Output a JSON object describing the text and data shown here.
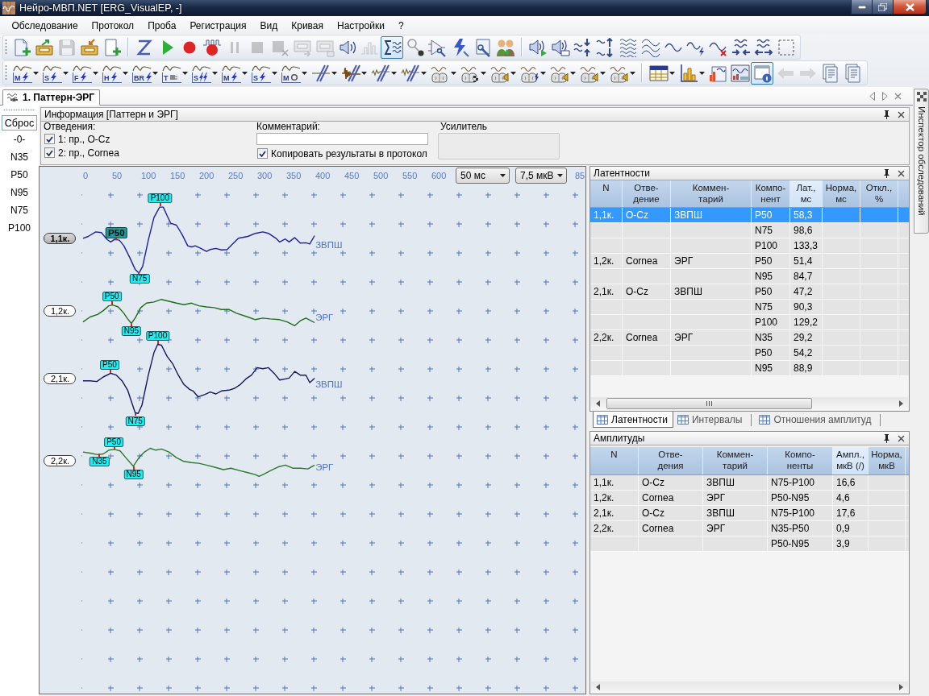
{
  "window": {
    "title": "Нейро-МВП.NET [ERG_VisualEP, -]"
  },
  "menu": [
    "Обследование",
    "Протокол",
    "Проба",
    "Регистрация",
    "Вид",
    "Кривая",
    "Настройки",
    "?"
  ],
  "toolbars": [
    {
      "buttons": [
        {
          "disabled": false,
          "pressed": false
        },
        {
          "disabled": false,
          "pressed": false
        },
        {
          "disabled": true,
          "pressed": false
        },
        {
          "disabled": false,
          "pressed": false
        },
        {
          "disabled": false,
          "pressed": false
        },
        {
          "disabled": false,
          "pressed": false
        },
        {
          "disabled": false,
          "pressed": false
        },
        {
          "disabled": false,
          "pressed": false
        },
        {
          "disabled": false,
          "pressed": false
        },
        {
          "disabled": true,
          "pressed": false
        },
        {
          "disabled": true,
          "pressed": false
        },
        {
          "disabled": true,
          "pressed": false
        },
        {
          "disabled": true,
          "pressed": false
        },
        {
          "disabled": true,
          "pressed": false
        },
        {
          "disabled": false,
          "pressed": false
        },
        {
          "disabled": true,
          "pressed": false
        },
        {
          "disabled": false,
          "pressed": true
        },
        {
          "disabled": false,
          "pressed": false
        },
        {
          "disabled": false,
          "pressed": false
        },
        {
          "disabled": false,
          "pressed": false
        },
        {
          "disabled": false,
          "pressed": false
        },
        {
          "disabled": false,
          "pressed": false
        },
        {
          "disabled": false,
          "pressed": false
        },
        {
          "disabled": false,
          "pressed": false
        },
        {
          "disabled": false,
          "pressed": false
        },
        {
          "disabled": false,
          "pressed": false
        },
        {
          "disabled": false,
          "pressed": false
        },
        {
          "disabled": false,
          "pressed": false
        },
        {
          "disabled": false,
          "pressed": false
        },
        {
          "disabled": false,
          "pressed": false
        },
        {
          "disabled": false,
          "pressed": false
        },
        {
          "disabled": false,
          "pressed": false
        },
        {
          "disabled": false,
          "pressed": false
        },
        {
          "disabled": false,
          "pressed": false
        }
      ]
    },
    {
      "buttons": [
        {
          "label": "M",
          "disabled": false,
          "pressed": false
        },
        {
          "label": "S",
          "disabled": false,
          "pressed": false
        },
        {
          "label": "F",
          "disabled": false,
          "pressed": false
        },
        {
          "label": "H",
          "disabled": false,
          "pressed": false
        },
        {
          "label": "BR",
          "disabled": false,
          "pressed": false
        },
        {
          "label": "T",
          "disabled": false,
          "pressed": false
        },
        {
          "label": "S",
          "disabled": false,
          "pressed": false
        },
        {
          "label": "M",
          "disabled": false,
          "pressed": false
        },
        {
          "label": "S",
          "disabled": false,
          "pressed": false
        },
        {
          "label": "M",
          "disabled": false,
          "pressed": false
        },
        {
          "disabled": false,
          "pressed": false
        },
        {
          "disabled": false,
          "pressed": false
        },
        {
          "disabled": false,
          "pressed": false
        },
        {
          "disabled": false,
          "pressed": false
        },
        {
          "disabled": false,
          "pressed": false
        },
        {
          "disabled": false,
          "pressed": false
        },
        {
          "disabled": false,
          "pressed": false
        },
        {
          "disabled": false,
          "pressed": false
        },
        {
          "disabled": false,
          "pressed": false
        },
        {
          "disabled": false,
          "pressed": false
        },
        {
          "disabled": false,
          "pressed": false
        },
        {
          "disabled": false,
          "pressed": false
        },
        {
          "disabled": false,
          "pressed": false
        },
        {
          "disabled": false,
          "pressed": false
        },
        {
          "disabled": false,
          "pressed": false
        },
        {
          "disabled": false,
          "pressed": true
        },
        {
          "disabled": true,
          "pressed": false
        },
        {
          "disabled": true,
          "pressed": false
        },
        {
          "disabled": false,
          "pressed": false
        },
        {
          "disabled": false,
          "pressed": false
        }
      ]
    }
  ],
  "document_tabs": [
    {
      "label": "1. Паттерн-ЭРГ",
      "selected": true
    }
  ],
  "inspector_tab": {
    "label": "Инспектор обследований"
  },
  "markers": {
    "reset": "Сброс",
    "items": [
      "-0-",
      "N35",
      "P50",
      "N95",
      "N75",
      "P100"
    ]
  },
  "info": {
    "title": "Информация [Паттерн и ЭРГ]",
    "leads_label": "Отведения:",
    "leads": [
      {
        "label": "1: пр., O-Cz",
        "checked": true
      },
      {
        "label": "2: пр., Cornea",
        "checked": true
      }
    ],
    "comment_label": "Комментарий:",
    "copy_results": {
      "label": "Копировать результаты в протокол",
      "checked": true
    },
    "amplifier_label": "Усилитель"
  },
  "plot": {
    "x_ticks": [
      "0",
      "50",
      "100",
      "150",
      "200",
      "250",
      "300",
      "350",
      "400",
      "450",
      "500",
      "550",
      "600",
      "85"
    ],
    "time_scale": "50 мс",
    "amplitude_scale": "7,5 мкВ",
    "traces": [
      {
        "label": "1,1к.",
        "selected": true,
        "comment": "ЗВПШ",
        "color": "#1f1fa0",
        "peaks": [
          {
            "label": "P50",
            "selected": true
          },
          {
            "label": "N75",
            "selected": false
          },
          {
            "label": "P100",
            "selected": false
          }
        ]
      },
      {
        "label": "1,2к.",
        "selected": false,
        "comment": "ЭРГ",
        "color": "#1e6e1e",
        "peaks": [
          {
            "label": "P50",
            "selected": false
          },
          {
            "label": "N95",
            "selected": false
          }
        ]
      },
      {
        "label": "2,1к.",
        "selected": false,
        "comment": "ЗВПШ",
        "color": "#17175c",
        "peaks": [
          {
            "label": "P50",
            "selected": false
          },
          {
            "label": "N75",
            "selected": false
          },
          {
            "label": "P100",
            "selected": false
          }
        ]
      },
      {
        "label": "2,2к.",
        "selected": false,
        "comment": "ЭРГ",
        "color": "#2a7a2a",
        "peaks": [
          {
            "label": "N35",
            "selected": false
          },
          {
            "label": "P50",
            "selected": false
          },
          {
            "label": "N95",
            "selected": false
          }
        ]
      }
    ]
  },
  "latency": {
    "title": "Латентности",
    "columns": [
      {
        "label": "N",
        "highlighted": false
      },
      {
        "label": "Отве-\nдение",
        "highlighted": false
      },
      {
        "label": "Коммен-\nтарий",
        "highlighted": false
      },
      {
        "label": "Компо-\nнент",
        "highlighted": false
      },
      {
        "label": "Лат.,\nмс",
        "highlighted": true
      },
      {
        "label": "Норма,\nмс",
        "highlighted": false
      },
      {
        "label": "Откл.,\n%",
        "highlighted": false
      }
    ],
    "rows": [
      {
        "n": "1,1к.",
        "lead": "O-Cz",
        "comment": "ЗВПШ",
        "component": "P50",
        "latency": "58,3",
        "selected": true
      },
      {
        "component": "N75",
        "latency": "98,6",
        "selected": false
      },
      {
        "component": "P100",
        "latency": "133,3",
        "selected": false
      },
      {
        "n": "1,2к.",
        "lead": "Cornea",
        "comment": "ЭРГ",
        "component": "P50",
        "latency": "51,4",
        "selected": false
      },
      {
        "component": "N95",
        "latency": "84,7",
        "selected": false
      },
      {
        "n": "2,1к.",
        "lead": "O-Cz",
        "comment": "ЗВПШ",
        "component": "P50",
        "latency": "47,2",
        "selected": false
      },
      {
        "component": "N75",
        "latency": "90,3",
        "selected": false
      },
      {
        "component": "P100",
        "latency": "129,2",
        "selected": false
      },
      {
        "n": "2,2к.",
        "lead": "Cornea",
        "comment": "ЭРГ",
        "component": "N35",
        "latency": "29,2",
        "selected": false
      },
      {
        "component": "P50",
        "latency": "54,2",
        "selected": false
      },
      {
        "component": "N95",
        "latency": "88,9",
        "selected": false
      }
    ],
    "tabs": [
      {
        "label": "Латентности",
        "selected": true
      },
      {
        "label": "Интервалы",
        "selected": false
      },
      {
        "label": "Отношения амплитуд",
        "selected": false
      }
    ]
  },
  "amplitudes": {
    "title": "Амплитуды",
    "columns": [
      {
        "label": "N",
        "highlighted": false
      },
      {
        "label": "Отве-\nдения",
        "highlighted": false
      },
      {
        "label": "Коммен-\nтарий",
        "highlighted": false
      },
      {
        "label": "Компо-\nненты",
        "highlighted": false
      },
      {
        "label": "Ампл.,\nмкВ (/)",
        "highlighted": true
      },
      {
        "label": "Норма,\nмкВ",
        "highlighted": false
      }
    ],
    "rows": [
      {
        "n": "1,1к.",
        "lead": "O-Cz",
        "comment": "ЗВПШ",
        "components": "N75-P100",
        "amplitude": "16,6",
        "selected": false
      },
      {
        "n": "1,2к.",
        "lead": "Cornea",
        "comment": "ЭРГ",
        "components": "P50-N95",
        "amplitude": "4,6",
        "selected": false
      },
      {
        "n": "2,1к.",
        "lead": "O-Cz",
        "comment": "ЗВПШ",
        "components": "N75-P100",
        "amplitude": "17,6",
        "selected": false
      },
      {
        "n": "2,2к.",
        "lead": "Cornea",
        "comment": "ЭРГ",
        "components": "N35-P50",
        "amplitude": "0,9",
        "selected": false
      },
      {
        "components": "P50-N95",
        "amplitude": "3,9",
        "selected": false
      }
    ]
  }
}
